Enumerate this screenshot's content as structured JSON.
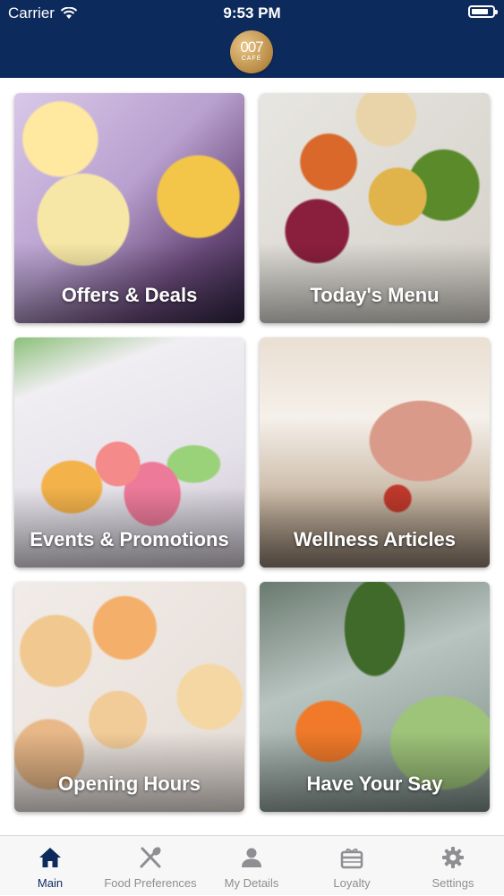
{
  "status_bar": {
    "carrier": "Carrier",
    "time": "9:53 PM",
    "battery_level": 0.8
  },
  "header": {
    "logo_number": "007",
    "logo_sub": "CAFÉ",
    "brand_color": "#0d2a5c"
  },
  "tiles": [
    {
      "label": "Offers & Deals"
    },
    {
      "label": "Today's Menu"
    },
    {
      "label": "Events & Promotions"
    },
    {
      "label": "Wellness Articles"
    },
    {
      "label": "Opening Hours"
    },
    {
      "label": "Have Your Say"
    }
  ],
  "tab_bar": {
    "active_color": "#0d2a5c",
    "inactive_color": "#8e8e93",
    "items": [
      {
        "label": "Main",
        "icon": "home-icon",
        "active": true
      },
      {
        "label": "Food Preferences",
        "icon": "fork-knife-icon",
        "active": false
      },
      {
        "label": "My Details",
        "icon": "person-icon",
        "active": false
      },
      {
        "label": "Loyalty",
        "icon": "gift-card-icon",
        "active": false
      },
      {
        "label": "Settings",
        "icon": "gear-icon",
        "active": false
      }
    ]
  }
}
